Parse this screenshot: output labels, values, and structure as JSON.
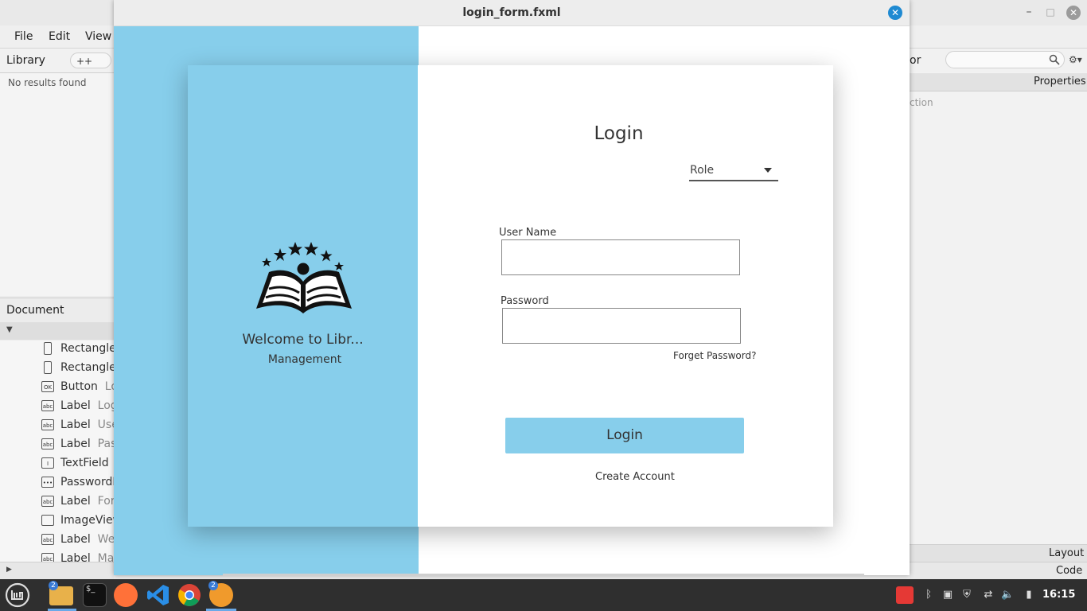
{
  "background_app": {
    "menu": [
      "File",
      "Edit",
      "View"
    ],
    "library": {
      "title": "Library",
      "add_button": "++",
      "empty_text": "No results found"
    },
    "document": {
      "title": "Document",
      "rows": [
        {
          "type": "Rectangle",
          "name": ""
        },
        {
          "type": "Rectangle",
          "name": ""
        },
        {
          "type": "Button",
          "name": "Lo"
        },
        {
          "type": "Label",
          "name": "Log"
        },
        {
          "type": "Label",
          "name": "Use"
        },
        {
          "type": "Label",
          "name": "Pas"
        },
        {
          "type": "TextField",
          "name": ""
        },
        {
          "type": "PasswordF",
          "name": ""
        },
        {
          "type": "Label",
          "name": "Forg"
        },
        {
          "type": "ImageView",
          "name": ""
        },
        {
          "type": "Label",
          "name": "Wel"
        },
        {
          "type": "Label",
          "name": "Mar"
        }
      ],
      "row_icons": [
        "rect",
        "rect",
        "OK",
        "abc",
        "abc",
        "abc",
        "I",
        "•••",
        "abc",
        "img",
        "abc",
        "abc"
      ]
    },
    "right_panel": {
      "header_partial": "or",
      "properties": "Properties",
      "partial_text": "ction",
      "layout": "Layout",
      "code": "Code"
    }
  },
  "preview_window": {
    "title": "login_form.fxml",
    "close_icon": "close-icon"
  },
  "login_card": {
    "welcome": "Welcome to Libr...",
    "subtitle": "Management",
    "heading": "Login",
    "role_select": {
      "value": "Role"
    },
    "username_label": "User Name",
    "username_value": "",
    "password_label": "Password",
    "password_value": "",
    "forgot_link": "Forget Password?",
    "login_button": "Login",
    "create_account": "Create Account",
    "accent_color": "#87ceeb"
  },
  "taskbar": {
    "files_badge": "2",
    "scenebuilder_badge": "2",
    "clock": "16:15"
  }
}
